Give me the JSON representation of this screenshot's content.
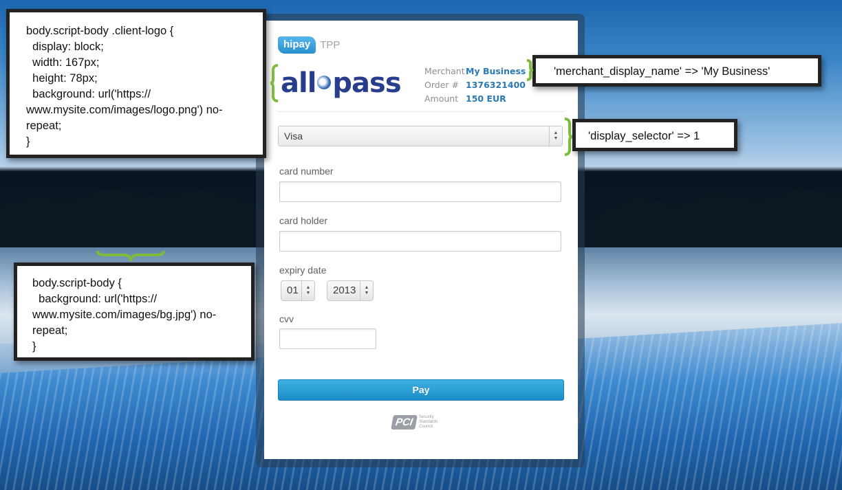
{
  "hipay": {
    "brand": "hipay",
    "suffix": "TPP"
  },
  "client_logo": {
    "text_left": "all",
    "text_right": "pass"
  },
  "merchant": {
    "rows": [
      {
        "key": "Merchant",
        "value": "My Business"
      },
      {
        "key": "Order #",
        "value": "1376321400"
      },
      {
        "key": "Amount",
        "value": "150 EUR"
      }
    ]
  },
  "payment": {
    "card_type": "Visa",
    "card_number_label": "card number",
    "card_holder_label": "card holder",
    "expiry_label": "expiry date",
    "expiry_month": "01",
    "expiry_year": "2013",
    "cvv_label": "cvv",
    "pay_label": "Pay"
  },
  "pci": {
    "mark": "PCI",
    "text": "Security Standards Council"
  },
  "annotations": {
    "logo_css": "body.script-body .client-logo {\n  display: block;\n  width: 167px;\n  height: 78px;\n  background: url('https://\nwww.mysite.com/images/logo.png') no-\nrepeat;\n}",
    "bg_css": "body.script-body {\n  background: url('https://\nwww.mysite.com/images/bg.jpg') no-\nrepeat;\n}",
    "merchant_display_name": "'merchant_display_name' => 'My Business'",
    "display_selector": "'display_selector' => 1"
  },
  "colors": {
    "brace": "#7dbb3d",
    "accent": "#2a79b5",
    "pay_button": "#1a8cc6"
  }
}
